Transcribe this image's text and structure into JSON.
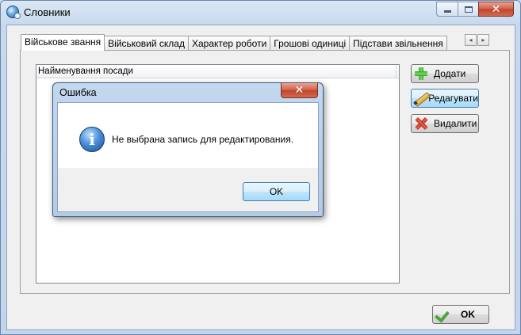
{
  "window": {
    "title": "Словники",
    "icon": "app-icon"
  },
  "tabs": [
    {
      "label": "Військове звання",
      "active": true
    },
    {
      "label": "Військовий склад",
      "active": false
    },
    {
      "label": "Характер роботи",
      "active": false
    },
    {
      "label": "Грошові одиниці",
      "active": false
    },
    {
      "label": "Підстави звільнення",
      "active": false
    }
  ],
  "tab_scroll": {
    "left": "◂",
    "right": "▸"
  },
  "grid": {
    "columns": [
      "Найменування посади"
    ],
    "rows": []
  },
  "side_buttons": {
    "add": "Додати",
    "edit": "Редагувати",
    "delete": "Видалити"
  },
  "footer": {
    "ok": "OK"
  },
  "dialog": {
    "title": "Ошибка",
    "message": "Не выбрана запись для редактирования.",
    "ok": "OK",
    "icon": "info-icon"
  },
  "colors": {
    "close_red": "#c0442c",
    "focus_blue": "#3c7fb1",
    "add_green": "#3aa52d"
  }
}
